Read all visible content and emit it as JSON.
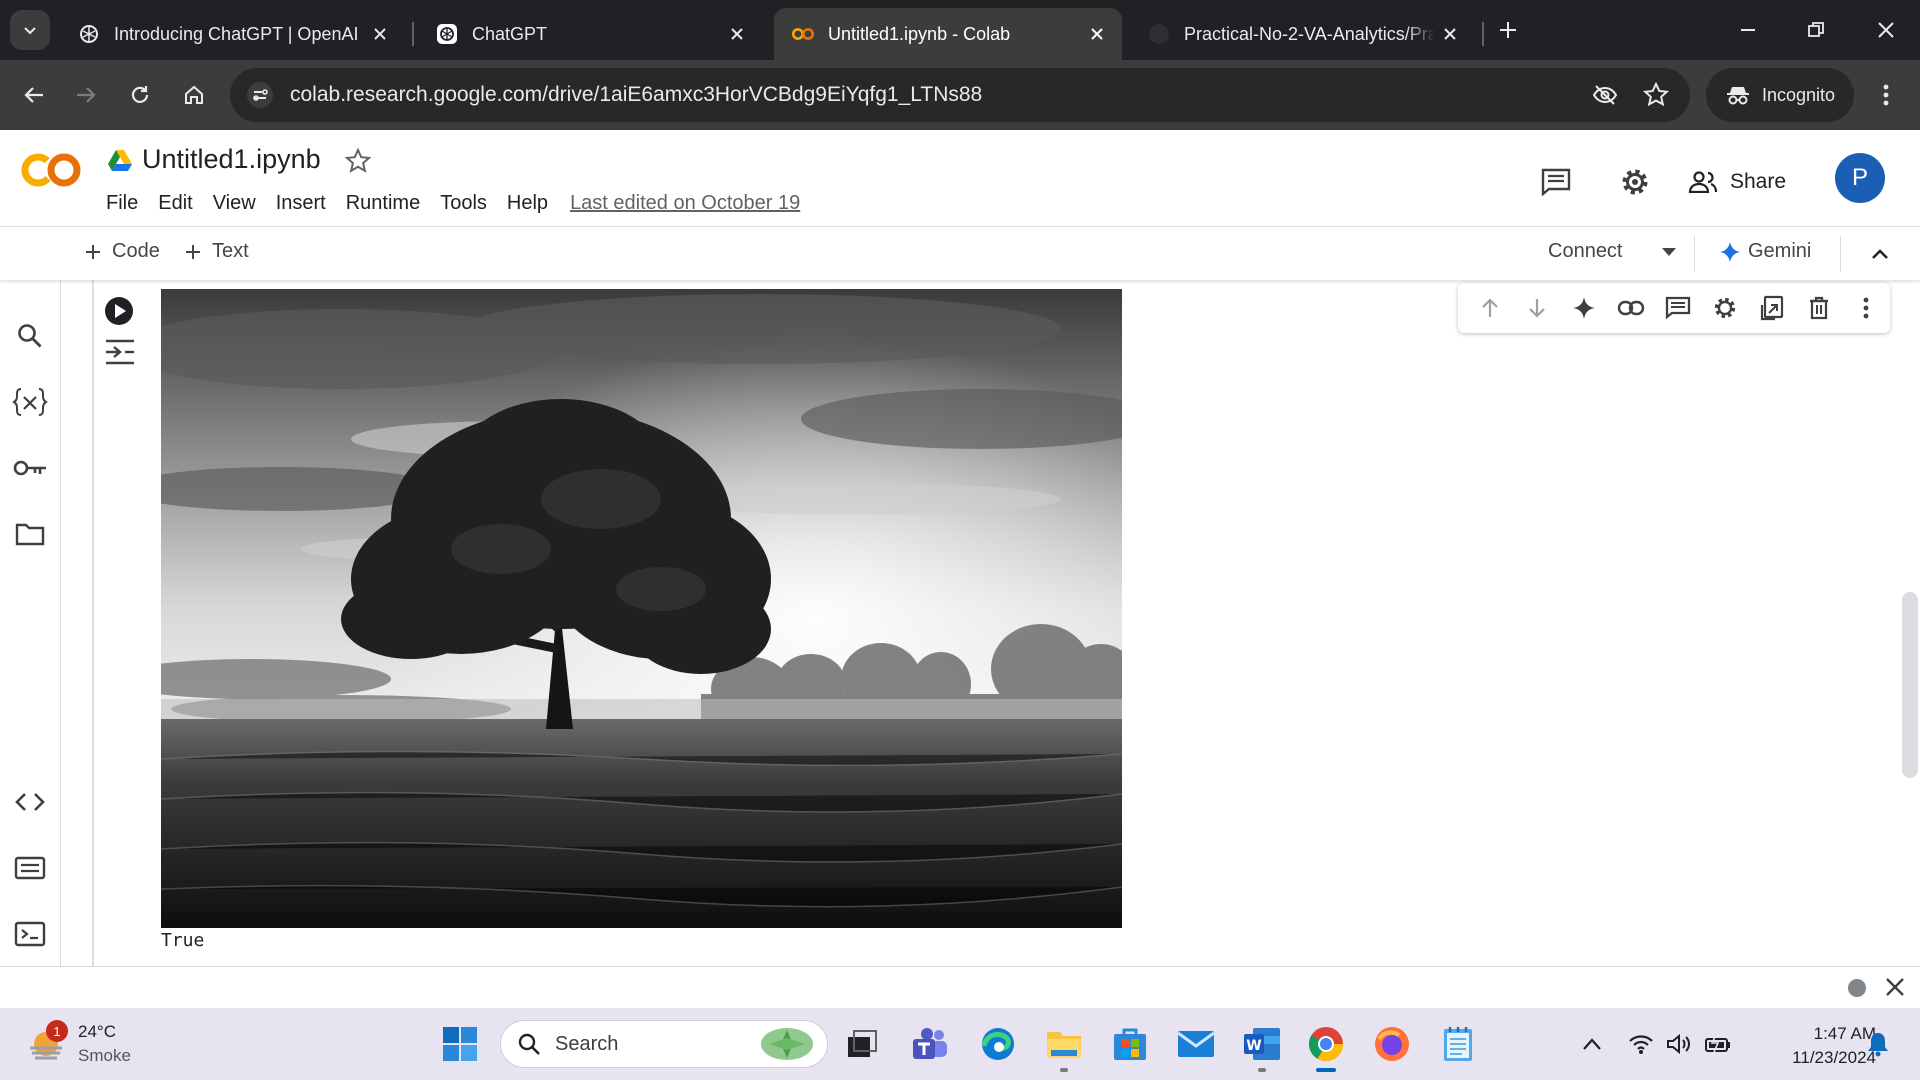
{
  "browser": {
    "tabs": [
      {
        "title": "Introducing ChatGPT | OpenAI",
        "icon": "openai-icon"
      },
      {
        "title": "ChatGPT",
        "icon": "openai-icon"
      },
      {
        "title": "Untitled1.ipynb - Colab",
        "icon": "colab-icon",
        "active": true
      },
      {
        "title": "Practical-No-2-VA-Analytics/Pra",
        "icon": "github-icon"
      }
    ],
    "url": "colab.research.google.com/drive/1aiE6amxc3HorVCBdg9EiYqfg1_LTNs88",
    "incognito_label": "Incognito"
  },
  "colab": {
    "logo_text": "CO",
    "doc_title": "Untitled1.ipynb",
    "menu": [
      "File",
      "Edit",
      "View",
      "Insert",
      "Runtime",
      "Tools",
      "Help"
    ],
    "last_edited": "Last edited on October 19",
    "share_label": "Share",
    "avatar_letter": "P",
    "toolbar": {
      "code_label": "Code",
      "text_label": "Text",
      "connect_label": "Connect",
      "gemini_label": "Gemini"
    },
    "output_text": "True",
    "output_image_desc_icon": "grayscale-tree-photo"
  },
  "taskbar": {
    "weather_temp": "24°C",
    "weather_desc": "Smoke",
    "notification_count": "1",
    "search_label": "Search",
    "time": "1:47 AM",
    "date": "11/23/2024"
  },
  "colors": {
    "chrome_dark": "#202124",
    "chrome_toolbar": "#3c3c3c",
    "colab_orange": "#f9ab00",
    "colab_orange_dark": "#e8710a",
    "avatar_blue": "#1a5fb4",
    "taskbar_bg": "#e8e3f0"
  }
}
